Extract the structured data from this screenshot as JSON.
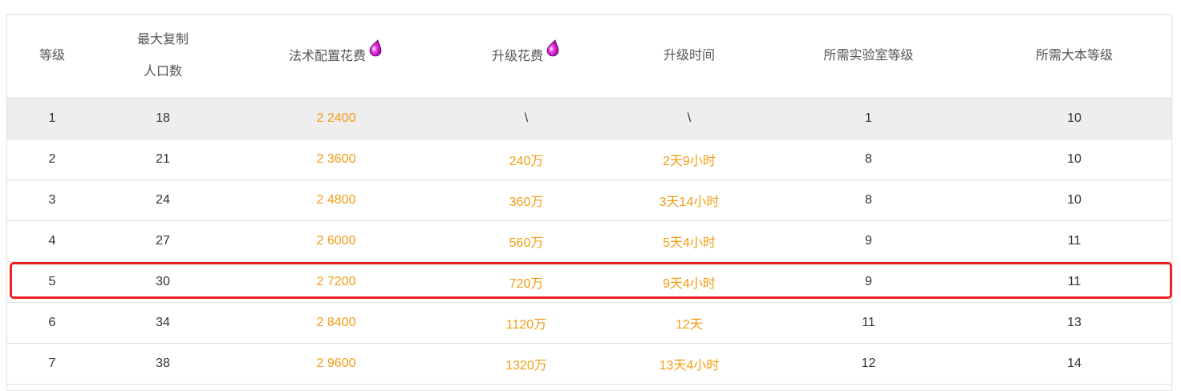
{
  "headers": {
    "level": "等级",
    "max_copy_line1": "最大复制",
    "max_copy_line2": "人口数",
    "spell_cost": "法术配置花费",
    "upgrade_cost": "升级花费",
    "upgrade_time": "升级时间",
    "lab_level": "所需实验室等级",
    "townhall_level": "所需大本等级"
  },
  "icons": {
    "resource": "dark-elixir-drop-icon"
  },
  "colors": {
    "accent_orange": "#f39c12",
    "highlight_red": "#ee2222",
    "shaded_row": "#eeeeee",
    "drop_purple": "#d21ad2"
  },
  "rows": [
    {
      "level": "1",
      "max_copy": "18",
      "spell_cost": "2 2400",
      "upgrade_cost": "\\",
      "upgrade_time": "\\",
      "lab_level": "1",
      "townhall_level": "10"
    },
    {
      "level": "2",
      "max_copy": "21",
      "spell_cost": "2 3600",
      "upgrade_cost": "240万",
      "upgrade_time": "2天9小时",
      "lab_level": "8",
      "townhall_level": "10"
    },
    {
      "level": "3",
      "max_copy": "24",
      "spell_cost": "2 4800",
      "upgrade_cost": "360万",
      "upgrade_time": "3天14小时",
      "lab_level": "8",
      "townhall_level": "10"
    },
    {
      "level": "4",
      "max_copy": "27",
      "spell_cost": "2 6000",
      "upgrade_cost": "560万",
      "upgrade_time": "5天4小时",
      "lab_level": "9",
      "townhall_level": "11"
    },
    {
      "level": "5",
      "max_copy": "30",
      "spell_cost": "2 7200",
      "upgrade_cost": "720万",
      "upgrade_time": "9天4小时",
      "lab_level": "9",
      "townhall_level": "11"
    },
    {
      "level": "6",
      "max_copy": "34",
      "spell_cost": "2 8400",
      "upgrade_cost": "1120万",
      "upgrade_time": "12天",
      "lab_level": "11",
      "townhall_level": "13"
    },
    {
      "level": "7",
      "max_copy": "38",
      "spell_cost": "2 9600",
      "upgrade_cost": "1320万",
      "upgrade_time": "13天4小时",
      "lab_level": "12",
      "townhall_level": "14"
    }
  ],
  "highlighted_row_level": "5"
}
